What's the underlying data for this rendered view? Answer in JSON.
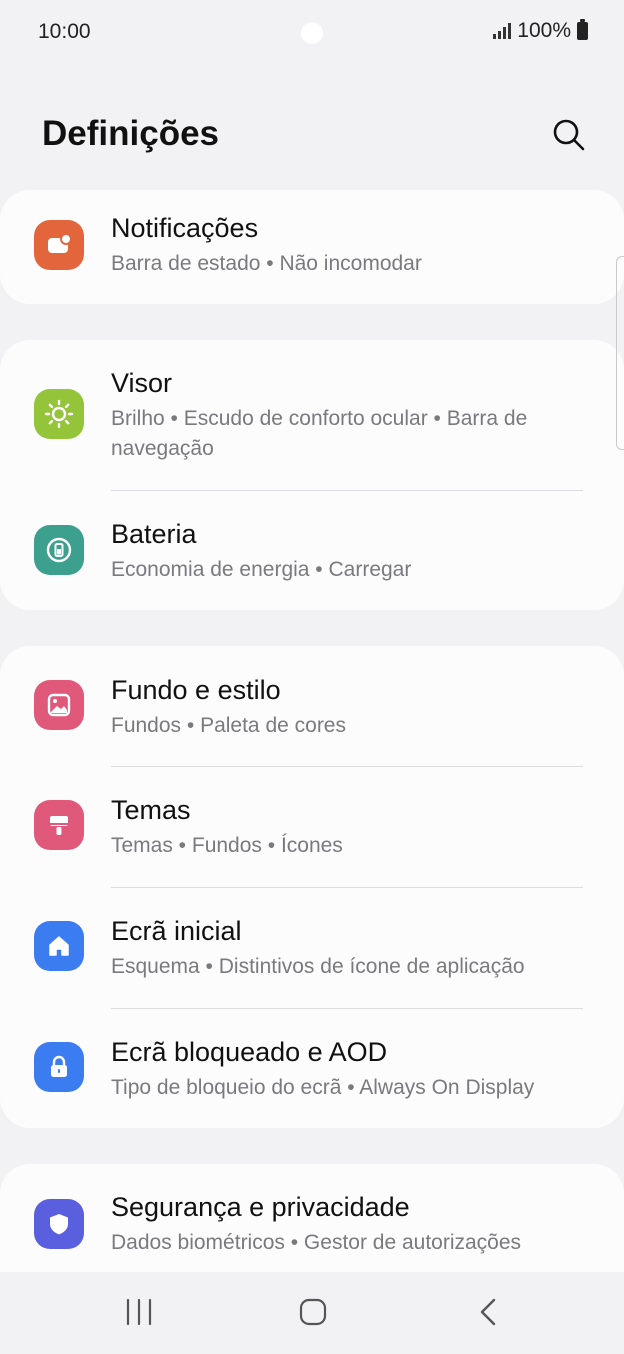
{
  "status_bar": {
    "time": "10:00",
    "battery_percent": "100%"
  },
  "header": {
    "title": "Definições"
  },
  "colors": {
    "notifications": "#e2653b",
    "display": "#93c43a",
    "battery": "#3d9f8d",
    "wallpaper": "#e0587a",
    "themes": "#e0587a",
    "home": "#3b7cf0",
    "lock": "#3b7cf0",
    "security": "#5a5fe0"
  },
  "groups": [
    {
      "items": [
        {
          "title": "Notificações",
          "subtitle": "Barra de estado  •  Não incomodar",
          "icon": "notification-icon"
        }
      ]
    },
    {
      "items": [
        {
          "title": "Visor",
          "subtitle": "Brilho  •  Escudo de conforto ocular  •  Barra de navegação",
          "icon": "brightness-icon"
        },
        {
          "title": "Bateria",
          "subtitle": "Economia de energia  •  Carregar",
          "icon": "battery-icon"
        }
      ]
    },
    {
      "items": [
        {
          "title": "Fundo e estilo",
          "subtitle": "Fundos  •  Paleta de cores",
          "icon": "wallpaper-icon"
        },
        {
          "title": "Temas",
          "subtitle": "Temas  •  Fundos  •  Ícones",
          "icon": "brush-icon"
        },
        {
          "title": "Ecrã inicial",
          "subtitle": "Esquema  •  Distintivos de ícone de aplicação",
          "icon": "home-icon"
        },
        {
          "title": "Ecrã bloqueado e AOD",
          "subtitle": "Tipo de bloqueio do ecrã  •  Always On Display",
          "icon": "lock-icon"
        }
      ]
    },
    {
      "items": [
        {
          "title": "Segurança e privacidade",
          "subtitle": "Dados biométricos  •  Gestor de autorizações",
          "icon": "shield-icon"
        }
      ]
    }
  ]
}
